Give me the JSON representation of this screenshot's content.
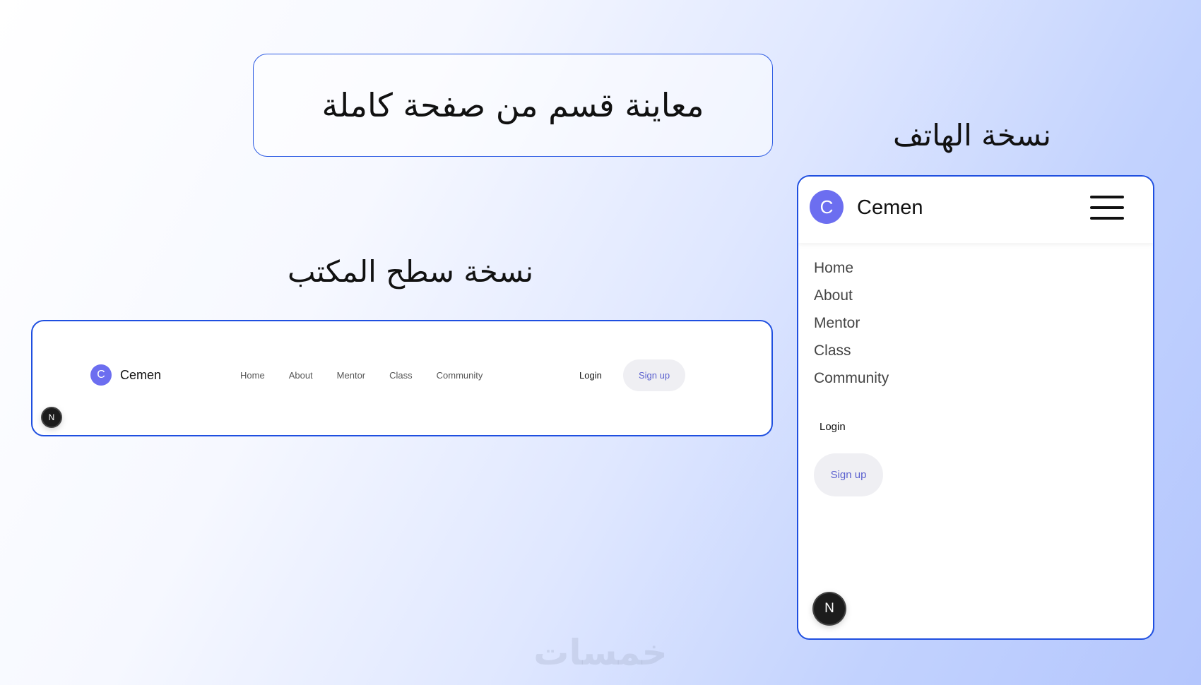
{
  "headline": "معاينة قسم من صفحة كاملة",
  "desktop_heading": "نسخة سطح المكتب",
  "mobile_heading": "نسخة الهاتف",
  "colors": {
    "frame_border": "#1f4fe0",
    "logo_bg": "#6c6ef0",
    "signup_text": "#5c62cf",
    "signup_bg": "#efeff3"
  },
  "desktop": {
    "logo_letter": "C",
    "brand": "Cemen",
    "nav": [
      "Home",
      "About",
      "Mentor",
      "Class",
      "Community"
    ],
    "login": "Login",
    "signup": "Sign up",
    "badge": "N"
  },
  "mobile": {
    "logo_letter": "C",
    "brand": "Cemen",
    "menu_icon": "hamburger-menu-icon",
    "nav": [
      "Home",
      "About",
      "Mentor",
      "Class",
      "Community"
    ],
    "login": "Login",
    "signup": "Sign up",
    "badge": "N"
  },
  "watermark": "خمسات"
}
